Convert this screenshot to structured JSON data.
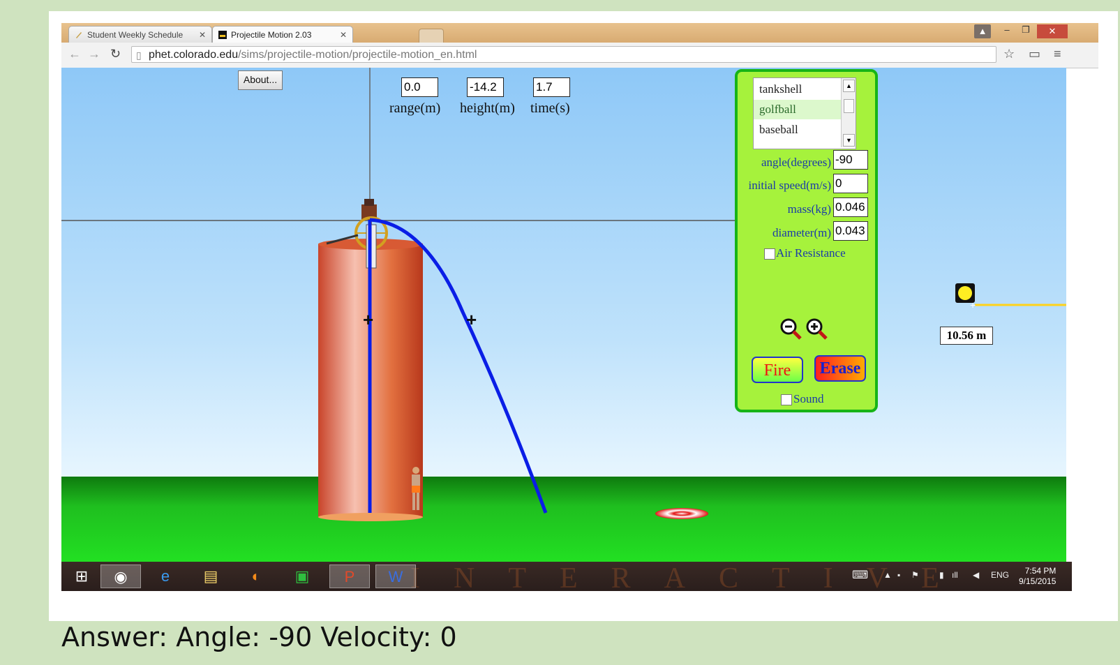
{
  "browser": {
    "tabs": [
      {
        "title": "Student Weekly Schedule",
        "active": false
      },
      {
        "title": "Projectile Motion 2.03",
        "active": true
      }
    ],
    "url_domain": "phet.colorado.edu",
    "url_path": "/sims/projectile-motion/projectile-motion_en.html"
  },
  "sim": {
    "about_label": "About...",
    "readouts": [
      {
        "value": "0.0",
        "label": "range(m)"
      },
      {
        "value": "-14.2",
        "label": "height(m)"
      },
      {
        "value": "1.7",
        "label": "time(s)"
      }
    ],
    "projectiles": [
      {
        "name": "tankshell",
        "selected": false
      },
      {
        "name": "golfball",
        "selected": true
      },
      {
        "name": "baseball",
        "selected": false
      }
    ],
    "params": [
      {
        "label": "angle(degrees)",
        "value": "-90"
      },
      {
        "label": "initial speed(m/s)",
        "value": "0"
      },
      {
        "label": "mass(kg)",
        "value": "0.046"
      },
      {
        "label": "diameter(m)",
        "value": "0.043"
      }
    ],
    "air_resistance_label": "Air Resistance",
    "air_resistance_checked": false,
    "fire_label": "Fire",
    "erase_label": "Erase",
    "sound_label": "Sound",
    "sound_checked": false,
    "measure_label": "10.56 m",
    "colors": {
      "trajectory": "#0a1ee6",
      "panel": "#a6f23c",
      "panel_border": "#17b417",
      "tape": "#ffd21a"
    }
  },
  "taskbar": {
    "watermark": "INTERACTIVE",
    "language": "ENG",
    "time": "7:54 PM",
    "date": "9/15/2015"
  },
  "answer_text": "Answer: Angle: -90 Velocity: 0"
}
